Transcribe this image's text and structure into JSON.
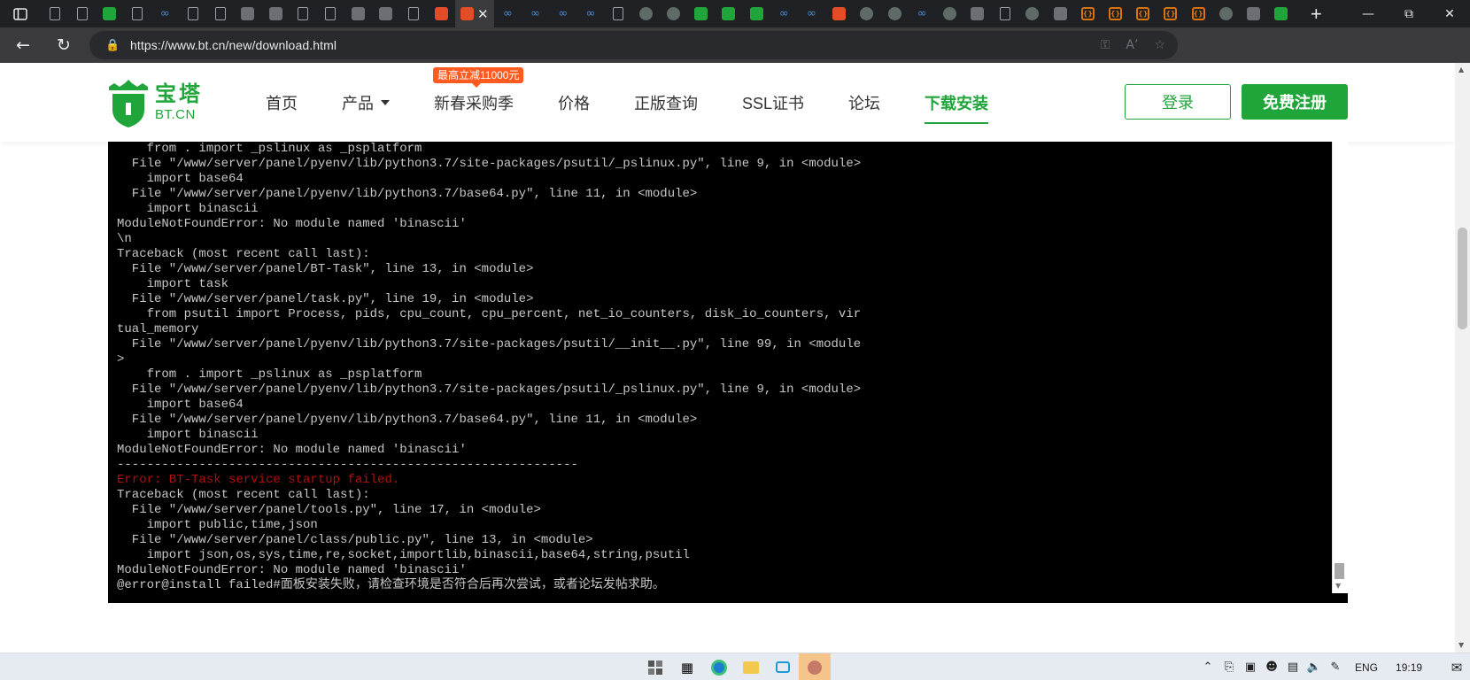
{
  "browser": {
    "url": "https://www.bt.cn/new/download.html",
    "tab_count_visible": 45
  },
  "site": {
    "logo_cn": "宝塔",
    "logo_en": "BT.CN",
    "nav": [
      {
        "label": "首页"
      },
      {
        "label": "产品"
      },
      {
        "label": "新春采购季"
      },
      {
        "label": "价格"
      },
      {
        "label": "正版查询"
      },
      {
        "label": "SSL证书"
      },
      {
        "label": "论坛"
      },
      {
        "label": "下载安装"
      }
    ],
    "promo_badge": "最高立减11000元",
    "login_label": "登录",
    "register_label": "免费注册",
    "brand_color": "#20a53a",
    "promo_color": "#ff5a1f"
  },
  "terminal": {
    "lines": [
      {
        "text": "    from . import _pslinux as _psplatform",
        "err": false
      },
      {
        "text": "  File \"/www/server/panel/pyenv/lib/python3.7/site-packages/psutil/_pslinux.py\", line 9, in <module>",
        "err": false
      },
      {
        "text": "    import base64",
        "err": false
      },
      {
        "text": "  File \"/www/server/panel/pyenv/lib/python3.7/base64.py\", line 11, in <module>",
        "err": false
      },
      {
        "text": "    import binascii",
        "err": false
      },
      {
        "text": "ModuleNotFoundError: No module named 'binascii'",
        "err": false
      },
      {
        "text": "\\n",
        "err": false
      },
      {
        "text": "Traceback (most recent call last):",
        "err": false
      },
      {
        "text": "  File \"/www/server/panel/BT-Task\", line 13, in <module>",
        "err": false
      },
      {
        "text": "    import task",
        "err": false
      },
      {
        "text": "  File \"/www/server/panel/task.py\", line 19, in <module>",
        "err": false
      },
      {
        "text": "    from psutil import Process, pids, cpu_count, cpu_percent, net_io_counters, disk_io_counters, vir",
        "err": false
      },
      {
        "text": "tual_memory",
        "err": false
      },
      {
        "text": "  File \"/www/server/panel/pyenv/lib/python3.7/site-packages/psutil/__init__.py\", line 99, in <module",
        "err": false
      },
      {
        "text": ">",
        "err": false
      },
      {
        "text": "    from . import _pslinux as _psplatform",
        "err": false
      },
      {
        "text": "  File \"/www/server/panel/pyenv/lib/python3.7/site-packages/psutil/_pslinux.py\", line 9, in <module>",
        "err": false
      },
      {
        "text": "    import base64",
        "err": false
      },
      {
        "text": "  File \"/www/server/panel/pyenv/lib/python3.7/base64.py\", line 11, in <module>",
        "err": false
      },
      {
        "text": "    import binascii",
        "err": false
      },
      {
        "text": "ModuleNotFoundError: No module named 'binascii'",
        "err": false
      },
      {
        "text": "--------------------------------------------------------------",
        "err": false
      },
      {
        "text": "Error: BT-Task service startup failed.",
        "err": true
      },
      {
        "text": "Traceback (most recent call last):",
        "err": false
      },
      {
        "text": "  File \"/www/server/panel/tools.py\", line 17, in <module>",
        "err": false
      },
      {
        "text": "    import public,time,json",
        "err": false
      },
      {
        "text": "  File \"/www/server/panel/class/public.py\", line 13, in <module>",
        "err": false
      },
      {
        "text": "    import json,os,sys,time,re,socket,importlib,binascii,base64,string,psutil",
        "err": false
      },
      {
        "text": "ModuleNotFoundError: No module named 'binascii'",
        "err": false
      },
      {
        "text": "@error@install failed#面板安装失败，请检查环境是否符合后再次尝试，或者论坛发帖求助。",
        "err": false
      }
    ]
  },
  "taskbar": {
    "lang": "ENG",
    "time": "19:19"
  }
}
